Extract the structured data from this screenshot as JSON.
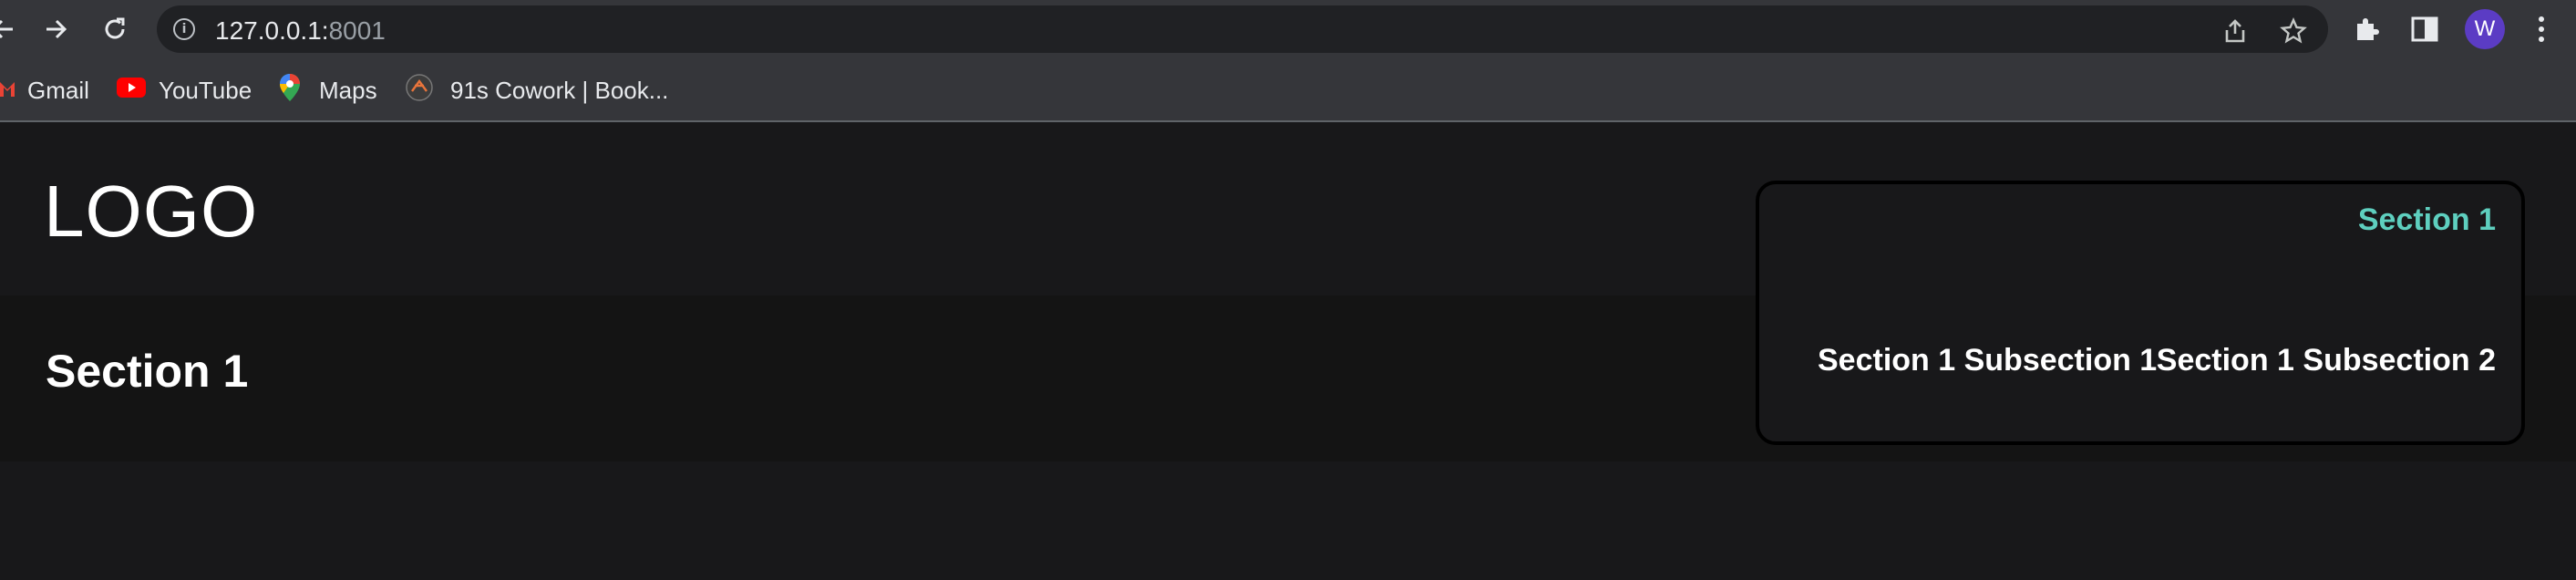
{
  "browser": {
    "url_host": "127.0.0.1:",
    "url_port": "8001",
    "avatar_initial": "W",
    "bookmarks": [
      {
        "label": "Gmail",
        "icon": "gmail-icon"
      },
      {
        "label": "YouTube",
        "icon": "youtube-icon"
      },
      {
        "label": "Maps",
        "icon": "maps-icon"
      },
      {
        "label": "91s Cowork | Book...",
        "icon": "cowork-icon"
      }
    ]
  },
  "site": {
    "logo": "LOGO",
    "section_title": "Section 1",
    "nav": {
      "active_section": "Section 1",
      "subsections": [
        "Section 1 Subsection 1",
        "Section 1 Subsection 2"
      ]
    },
    "colors": {
      "accent": "#5ecfbf",
      "background": "#18181a",
      "band": "#141414"
    }
  }
}
